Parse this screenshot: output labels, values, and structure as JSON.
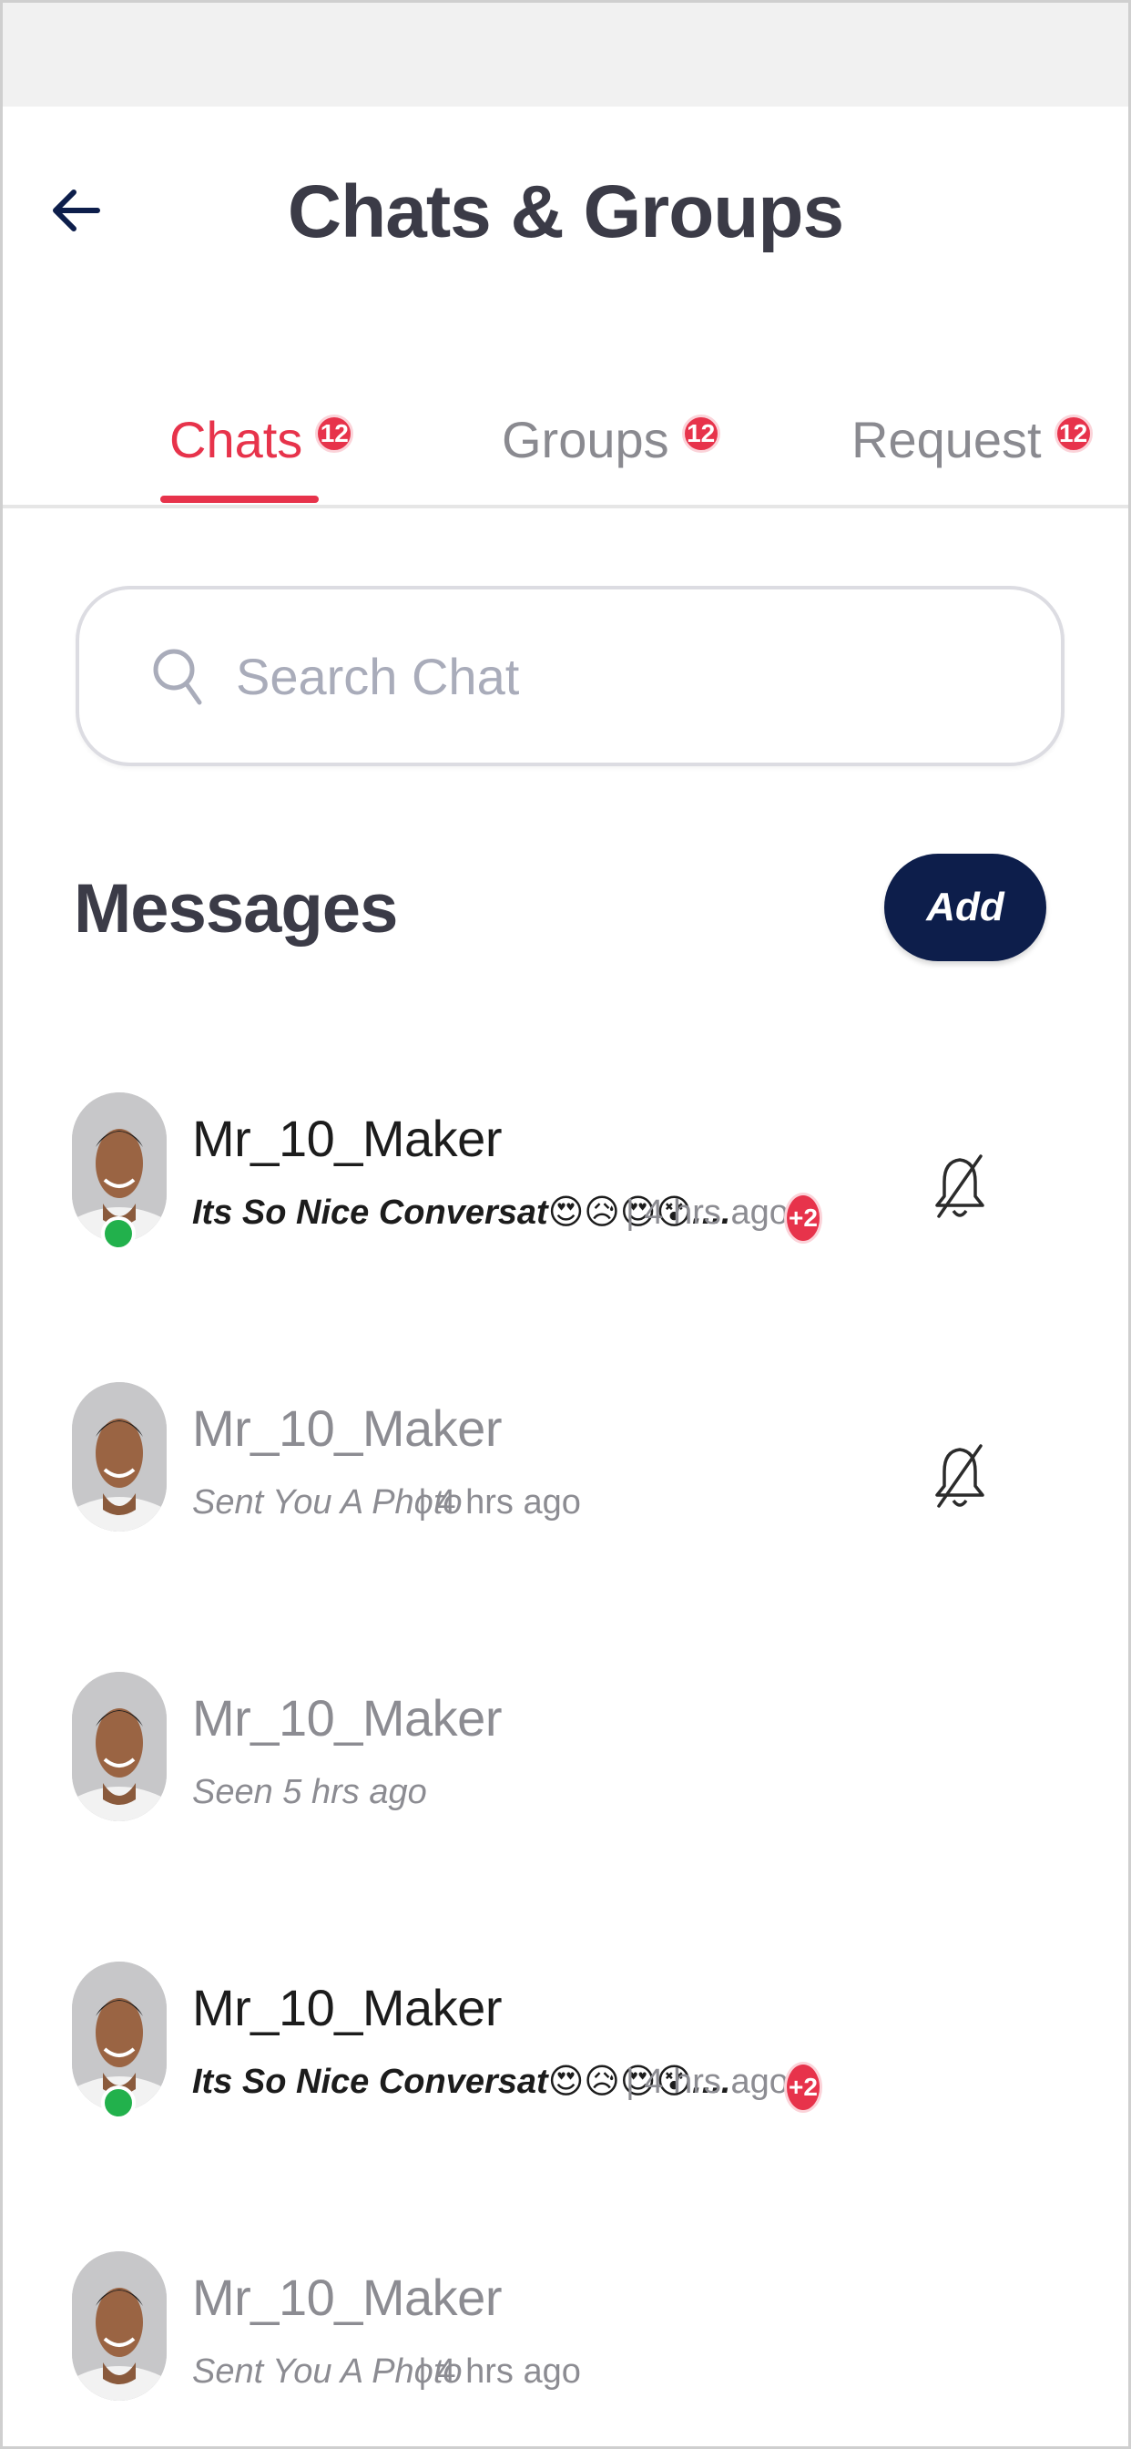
{
  "header": {
    "title": "Chats & Groups",
    "back_icon": "arrow-left-icon"
  },
  "tabs": [
    {
      "label": "Chats",
      "badge": "12",
      "active": true
    },
    {
      "label": "Groups",
      "badge": "12",
      "active": false
    },
    {
      "label": "Request",
      "badge": "12",
      "active": false
    }
  ],
  "search": {
    "placeholder": "Search Chat",
    "value": "",
    "icon": "search-icon"
  },
  "messages": {
    "title": "Messages",
    "add_label": "Add"
  },
  "chats": [
    {
      "name": "Mr_10_Maker",
      "preview": "Its So Nice Conversat😍😥😍😵....",
      "time": "| 4 hrs ago",
      "badge": "+2",
      "online": true,
      "unread": true,
      "muted": true
    },
    {
      "name": "Mr_10_Maker",
      "preview": "Sent You A Photo",
      "time": "| 4 hrs ago",
      "badge": "",
      "online": false,
      "unread": false,
      "muted": true
    },
    {
      "name": "Mr_10_Maker",
      "preview": "Seen 5 hrs ago",
      "time": "",
      "badge": "",
      "online": false,
      "unread": false,
      "muted": false
    },
    {
      "name": "Mr_10_Maker",
      "preview": "Its So Nice Conversat😍😥😍😵....",
      "time": "| 4 hrs ago",
      "badge": "+2",
      "online": true,
      "unread": true,
      "muted": false
    },
    {
      "name": "Mr_10_Maker",
      "preview": "Sent You A Photo",
      "time": "| 4 hrs ago",
      "badge": "",
      "online": false,
      "unread": false,
      "muted": false
    }
  ],
  "colors": {
    "accent": "#e7334b",
    "primary_button": "#0d1e4b",
    "online": "#22b14c",
    "muted_text": "#8c8c92"
  }
}
